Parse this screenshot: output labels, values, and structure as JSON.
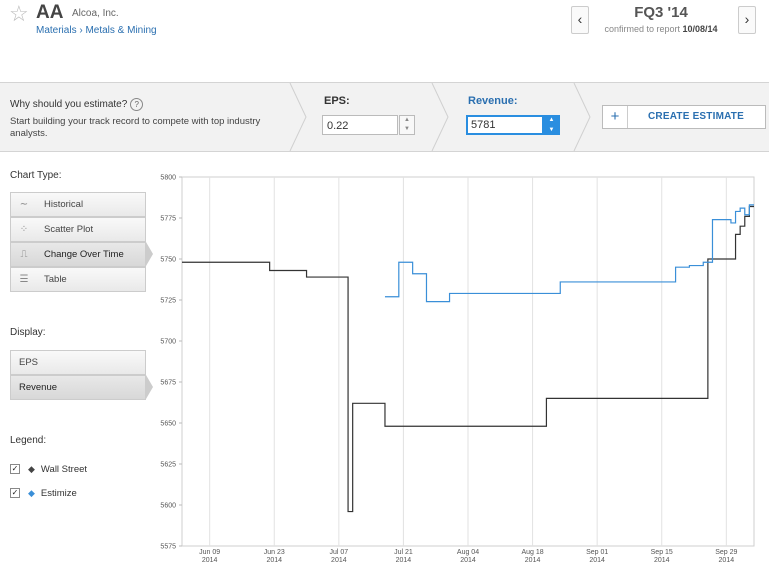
{
  "header": {
    "star_glyph": "☆",
    "ticker": "AA",
    "company": "Alcoa, Inc.",
    "breadcrumb": "Materials › Metals & Mining",
    "prev_glyph": "‹",
    "next_glyph": "›",
    "quarter": "FQ3 '14",
    "confirmed_prefix": "confirmed to report",
    "confirmed_date": "10/08/14"
  },
  "estimate": {
    "why_label": "Why should you estimate?",
    "help_glyph": "?",
    "why_desc": "Start building your track record to compete with top industry analysts.",
    "eps_label": "EPS:",
    "eps_value": "0.22",
    "revenue_label": "Revenue:",
    "revenue_value": "5781",
    "create_plus": "+",
    "create_label": "CREATE ESTIMATE"
  },
  "sidebar": {
    "chart_type_label": "Chart Type:",
    "chart_types": [
      {
        "label": "Historical",
        "icon": "wave-icon",
        "glyph": "∼"
      },
      {
        "label": "Scatter Plot",
        "icon": "scatter-icon",
        "glyph": "⁘"
      },
      {
        "label": "Change Over Time",
        "icon": "step-icon",
        "glyph": "⎍"
      },
      {
        "label": "Table",
        "icon": "table-icon",
        "glyph": "☰"
      }
    ],
    "chart_type_selected": "Change Over Time",
    "display_label": "Display:",
    "display_items": [
      "EPS",
      "Revenue"
    ],
    "display_selected": "Revenue",
    "legend_label": "Legend:",
    "legend": [
      {
        "label": "Wall Street",
        "marker": "◆",
        "color": "#444444",
        "checked": true
      },
      {
        "label": "Estimize",
        "marker": "◆",
        "color": "#3a8fd8",
        "checked": true
      }
    ],
    "check_glyph": "✓"
  },
  "chart_data": {
    "type": "line",
    "ylim": [
      5575,
      5800
    ],
    "yticks": [
      5575,
      5600,
      5625,
      5650,
      5675,
      5700,
      5725,
      5750,
      5775,
      5800
    ],
    "xlim": [
      "2014-06-03",
      "2014-10-05"
    ],
    "xticks": [
      {
        "date": "2014-06-09",
        "label": "Jun 09",
        "year": "2014"
      },
      {
        "date": "2014-06-23",
        "label": "Jun 23",
        "year": "2014"
      },
      {
        "date": "2014-07-07",
        "label": "Jul 07",
        "year": "2014"
      },
      {
        "date": "2014-07-21",
        "label": "Jul 21",
        "year": "2014"
      },
      {
        "date": "2014-08-04",
        "label": "Aug 04",
        "year": "2014"
      },
      {
        "date": "2014-08-18",
        "label": "Aug 18",
        "year": "2014"
      },
      {
        "date": "2014-09-01",
        "label": "Sep 01",
        "year": "2014"
      },
      {
        "date": "2014-09-15",
        "label": "Sep 15",
        "year": "2014"
      },
      {
        "date": "2014-09-29",
        "label": "Sep 29",
        "year": "2014"
      }
    ],
    "grid": "vertical",
    "series": [
      {
        "name": "Wall Street",
        "color": "#333333",
        "step": true,
        "points": [
          [
            "2014-06-03",
            5748
          ],
          [
            "2014-06-22",
            5743
          ],
          [
            "2014-06-30",
            5739
          ],
          [
            "2014-07-09",
            5596
          ],
          [
            "2014-07-10",
            5662
          ],
          [
            "2014-07-17",
            5648
          ],
          [
            "2014-08-21",
            5665
          ],
          [
            "2014-09-25",
            5750
          ],
          [
            "2014-10-01",
            5765
          ],
          [
            "2014-10-02",
            5770
          ],
          [
            "2014-10-03",
            5776
          ],
          [
            "2014-10-04",
            5782
          ],
          [
            "2014-10-05",
            5782
          ]
        ]
      },
      {
        "name": "Estimize",
        "color": "#3a8fd8",
        "step": true,
        "points": [
          [
            "2014-07-17",
            5727
          ],
          [
            "2014-07-20",
            5748
          ],
          [
            "2014-07-23",
            5741
          ],
          [
            "2014-07-26",
            5724
          ],
          [
            "2014-07-31",
            5729
          ],
          [
            "2014-08-24",
            5736
          ],
          [
            "2014-09-18",
            5745
          ],
          [
            "2014-09-21",
            5746
          ],
          [
            "2014-09-24",
            5748
          ],
          [
            "2014-09-26",
            5774
          ],
          [
            "2014-09-30",
            5772
          ],
          [
            "2014-10-01",
            5779
          ],
          [
            "2014-10-02",
            5781
          ],
          [
            "2014-10-03",
            5777
          ],
          [
            "2014-10-04",
            5783
          ],
          [
            "2014-10-05",
            5783
          ]
        ]
      }
    ]
  }
}
